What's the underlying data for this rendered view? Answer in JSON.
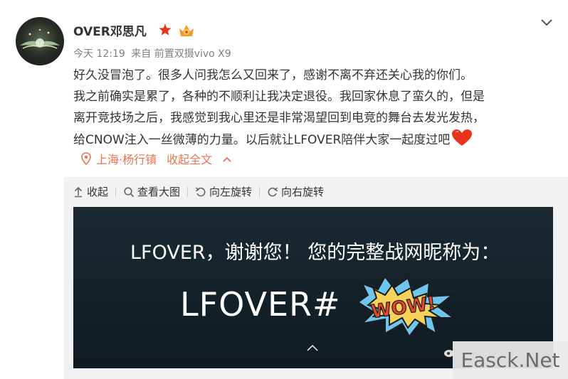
{
  "post": {
    "username": "OVER邓思凡",
    "meta": {
      "time": "今天 12:19",
      "source": "来自 前置双摄vivo X9"
    },
    "content_lines": [
      "好久没冒泡了。很多人问我怎么又回来了，感谢不离不弃还关心我的你们。",
      "我之前确实是累了，各种的不顺利让我决定退役。我回家休息了蛮久的，但是",
      "离开竞技场之后，我感觉到我心里还是非常渴望回到电竞的舞台去发光发热，",
      "给CNOW注入一丝微薄的力量。以后就让LFOVER陪伴大家一起度过吧"
    ],
    "location": "上海·杨行镇",
    "collapse_label": "收起全文"
  },
  "toolbar": {
    "collapse": "收起",
    "view_large": "查看大图",
    "rotate_left": "向左旋转",
    "rotate_right": "向右旋转"
  },
  "image": {
    "thanks_text": "LFOVER，谢谢您！ 您的完整战网昵称为：",
    "nickname": "LFOVER#",
    "wow_text": "WOW!"
  },
  "watermark": "Easck.Net",
  "colors": {
    "accent": "#eb7350",
    "text": "#333333",
    "meta": "#808080",
    "panel": "#f2f2f5",
    "star": "#e8341c",
    "heart": "#e8341c"
  },
  "icons": {
    "star": "star-badge-icon",
    "vip": "vip-crown-icon",
    "dropdown": "chevron-down-icon",
    "location": "location-pin-icon",
    "up": "chevron-up-icon",
    "collapse": "arrow-up-icon",
    "search": "magnifier-icon",
    "rotate_left": "rotate-left-icon",
    "rotate_right": "rotate-right-icon",
    "heart": "heart-icon",
    "weibo": "weibo-logo-icon"
  }
}
